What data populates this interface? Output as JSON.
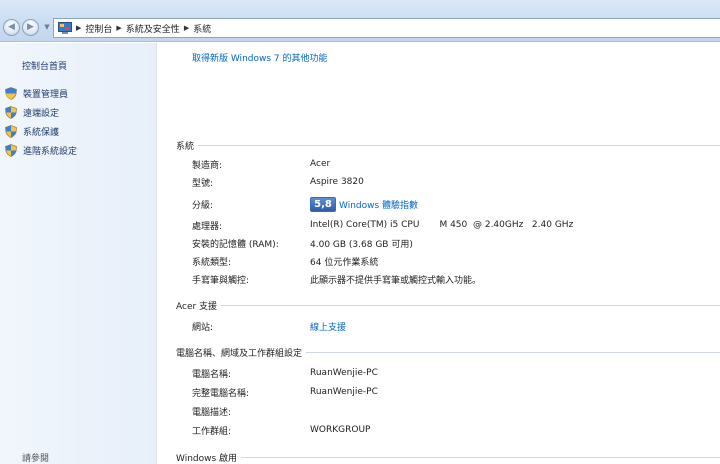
{
  "breadcrumb": {
    "items": [
      "控制台",
      "系統及安全性",
      "系統"
    ]
  },
  "left_pane": {
    "home": "控制台首頁",
    "items": [
      {
        "label": "裝置管理員"
      },
      {
        "label": "遠端設定"
      },
      {
        "label": "系統保護"
      },
      {
        "label": "進階系統設定"
      }
    ],
    "see_also": "請參閱"
  },
  "main": {
    "top_link": "取得新版 Windows 7 的其他功能",
    "system": {
      "heading": "系統",
      "manufacturer_label": "製造商:",
      "manufacturer": "Acer",
      "model_label": "型號:",
      "model": "Aspire 3820",
      "rating_label": "分級:",
      "rating_score": "5,8",
      "rating_link": "Windows 體驗指數",
      "processor_label": "處理器:",
      "processor": "Intel(R) Core(TM) i5 CPU       M 450  @ 2.40GHz   2.40 GHz",
      "ram_label": "安裝的記憶體 (RAM):",
      "ram": "4.00 GB (3.68 GB 可用)",
      "type_label": "系統類型:",
      "type": "64 位元作業系統",
      "pen_label": "手寫筆與觸控:",
      "pen": "此顯示器不提供手寫筆或觸控式輸入功能。"
    },
    "support": {
      "heading": "Acer 支援",
      "website_label": "網站:",
      "website": "線上支援"
    },
    "computer": {
      "heading": "電腦名稱、網域及工作群組設定",
      "name_label": "電腦名稱:",
      "name": "RuanWenjie-PC",
      "full_name_label": "完整電腦名稱:",
      "full_name": "RuanWenjie-PC",
      "desc_label": "電腦描述:",
      "desc": "",
      "workgroup_label": "工作群組:",
      "workgroup": "WORKGROUP"
    },
    "activation": {
      "heading": "Windows 啟用"
    }
  },
  "colors": {
    "link": "#0066cc",
    "nav_text": "#1d3a6a"
  }
}
